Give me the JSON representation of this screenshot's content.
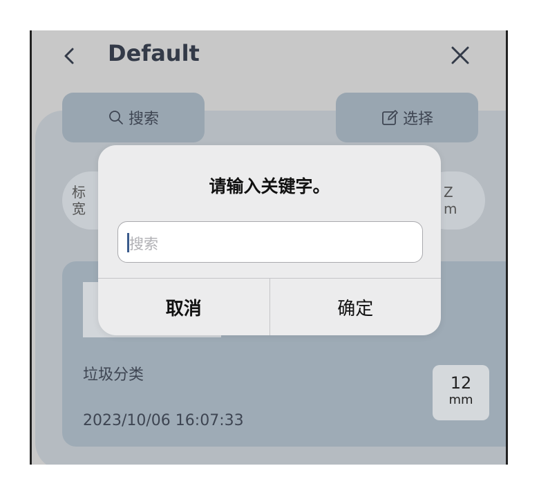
{
  "header": {
    "title": "Default"
  },
  "toolbar": {
    "search_label": "搜索",
    "select_label": "选择"
  },
  "info": {
    "left_line1": "标",
    "left_line2": "宽",
    "right_line1": "Z",
    "right_line2": "m"
  },
  "card": {
    "name": "垃圾分类",
    "date": "2023/10/06 16:07:33",
    "size_value": "12",
    "size_unit": "mm"
  },
  "dialog": {
    "title": "请输入关键字。",
    "input_placeholder": "搜索",
    "input_value": "",
    "cancel_label": "取消",
    "confirm_label": "确定"
  },
  "colors": {
    "background": "#c8c8c8",
    "panel": "#b5bbc1",
    "button": "#99a6b1",
    "card": "#9eabb6",
    "dialog": "#ececed",
    "caret": "#3a5b8c"
  },
  "icons": {
    "back": "chevron-left-icon",
    "close": "close-icon",
    "search": "search-icon",
    "edit": "edit-icon"
  }
}
